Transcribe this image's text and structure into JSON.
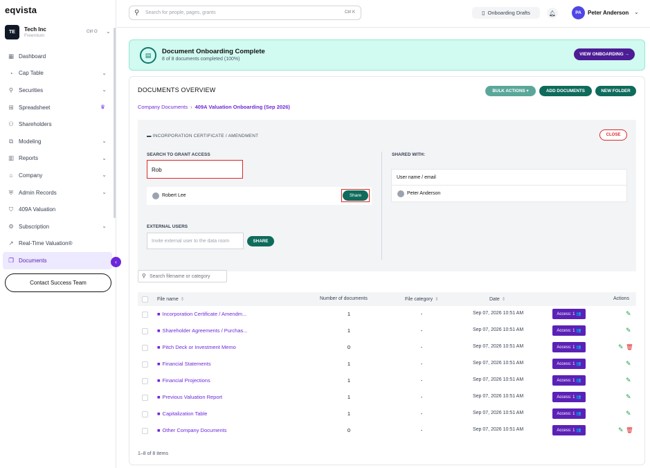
{
  "app": {
    "logo": "eqvista"
  },
  "org": {
    "avatar": "TE",
    "name": "Tech Inc",
    "plan": "Freemium",
    "shortcut": "Ctrl O"
  },
  "sidebar": {
    "items": [
      {
        "label": "Dashboard",
        "icon": "dashboard-icon",
        "glyph": "▦"
      },
      {
        "label": "Cap Table",
        "icon": "pie-icon",
        "glyph": "◔"
      },
      {
        "label": "Securities",
        "icon": "securities-icon",
        "glyph": "⚲"
      },
      {
        "label": "Spreadsheet",
        "icon": "grid-icon",
        "glyph": "⊞"
      },
      {
        "label": "Shareholders",
        "icon": "users-icon",
        "glyph": "⚇"
      },
      {
        "label": "Modeling",
        "icon": "modeling-icon",
        "glyph": "⧉"
      },
      {
        "label": "Reports",
        "icon": "reports-icon",
        "glyph": "▥"
      },
      {
        "label": "Company",
        "icon": "company-icon",
        "glyph": "⌂"
      },
      {
        "label": "Admin Records",
        "icon": "admin-icon",
        "glyph": "⛨"
      },
      {
        "label": "409A Valuation",
        "icon": "shield-icon",
        "glyph": "⛉"
      },
      {
        "label": "Subscription",
        "icon": "subscription-icon",
        "glyph": "⚙"
      },
      {
        "label": "Real-Time Valuation®",
        "icon": "chart-line-icon",
        "glyph": "↗"
      },
      {
        "label": "Documents",
        "icon": "documents-icon",
        "glyph": "❐"
      }
    ],
    "contact_label": "Contact Success Team"
  },
  "topbar": {
    "search_placeholder": "Search for people, pages, grants",
    "search_shortcut": "Ctrl K",
    "drafts_label": "Onboarding Drafts",
    "user_initials": "PA",
    "user_name": "Peter Anderson"
  },
  "banner": {
    "title": "Document Onboarding Complete",
    "subtitle": "8 of 8 documents completed (100%)",
    "button": "VIEW ONBOARDING →"
  },
  "main": {
    "title": "DOCUMENTS OVERVIEW",
    "bulk_actions": "BULK ACTIONS ▾",
    "add_documents": "ADD DOCUMENTS",
    "new_folder": "NEW FOLDER",
    "breadcrumb": {
      "root": "Company Documents",
      "sep": "›",
      "current": "409A Valuation Onboarding (Sep 2026)"
    }
  },
  "share_panel": {
    "folder_title": "INCORPORATION CERTIFICATE / AMENDMENT",
    "close": "CLOSE",
    "grant_label": "SEARCH TO GRANT ACCESS",
    "grant_value": "Rob",
    "result_name": "Robert Lee",
    "result_share": "Share",
    "external_label": "EXTERNAL USERS",
    "external_placeholder": "Invite external user to the data room",
    "external_share": "SHARE",
    "shared_with_label": "SHARED WITH:",
    "shared_head": "User name / email",
    "shared_users": [
      "Peter Anderson"
    ]
  },
  "file_search": {
    "placeholder": "Search filename or category"
  },
  "table": {
    "headers": {
      "name": "File name",
      "count": "Number of documents",
      "category": "File category",
      "date": "Date",
      "actions": "Actions"
    },
    "rows": [
      {
        "name": "Incorporation Certificate / Amendm...",
        "count": "1",
        "category": "-",
        "date": "Sep 07, 2026 10:51 AM",
        "access": "Access: 1 👥",
        "deletable": false
      },
      {
        "name": "Shareholder Agreements / Purchas...",
        "count": "1",
        "category": "-",
        "date": "Sep 07, 2026 10:51 AM",
        "access": "Access: 1 👥",
        "deletable": false
      },
      {
        "name": "Pitch Deck or Investment Memo",
        "count": "0",
        "category": "-",
        "date": "Sep 07, 2026 10:51 AM",
        "access": "Access: 1 👥",
        "deletable": true
      },
      {
        "name": "Financial Statements",
        "count": "1",
        "category": "-",
        "date": "Sep 07, 2026 10:51 AM",
        "access": "Access: 1 👥",
        "deletable": false
      },
      {
        "name": "Financial Projections",
        "count": "1",
        "category": "-",
        "date": "Sep 07, 2026 10:51 AM",
        "access": "Access: 1 👥",
        "deletable": false
      },
      {
        "name": "Previous Valuation Report",
        "count": "1",
        "category": "-",
        "date": "Sep 07, 2026 10:51 AM",
        "access": "Access: 1 👥",
        "deletable": false
      },
      {
        "name": "Capitalization Table",
        "count": "1",
        "category": "-",
        "date": "Sep 07, 2026 10:51 AM",
        "access": "Access: 1 👥",
        "deletable": false
      },
      {
        "name": "Other Company Documents",
        "count": "0",
        "category": "-",
        "date": "Sep 07, 2026 10:51 AM",
        "access": "Access: 1 👥",
        "deletable": true
      }
    ],
    "pager": "1–8 of 8 items"
  },
  "colors": {
    "accent": "#6d28d9",
    "teal": "#0f6b5c",
    "danger": "#dc2626",
    "banner_bg": "#d1faf0"
  }
}
